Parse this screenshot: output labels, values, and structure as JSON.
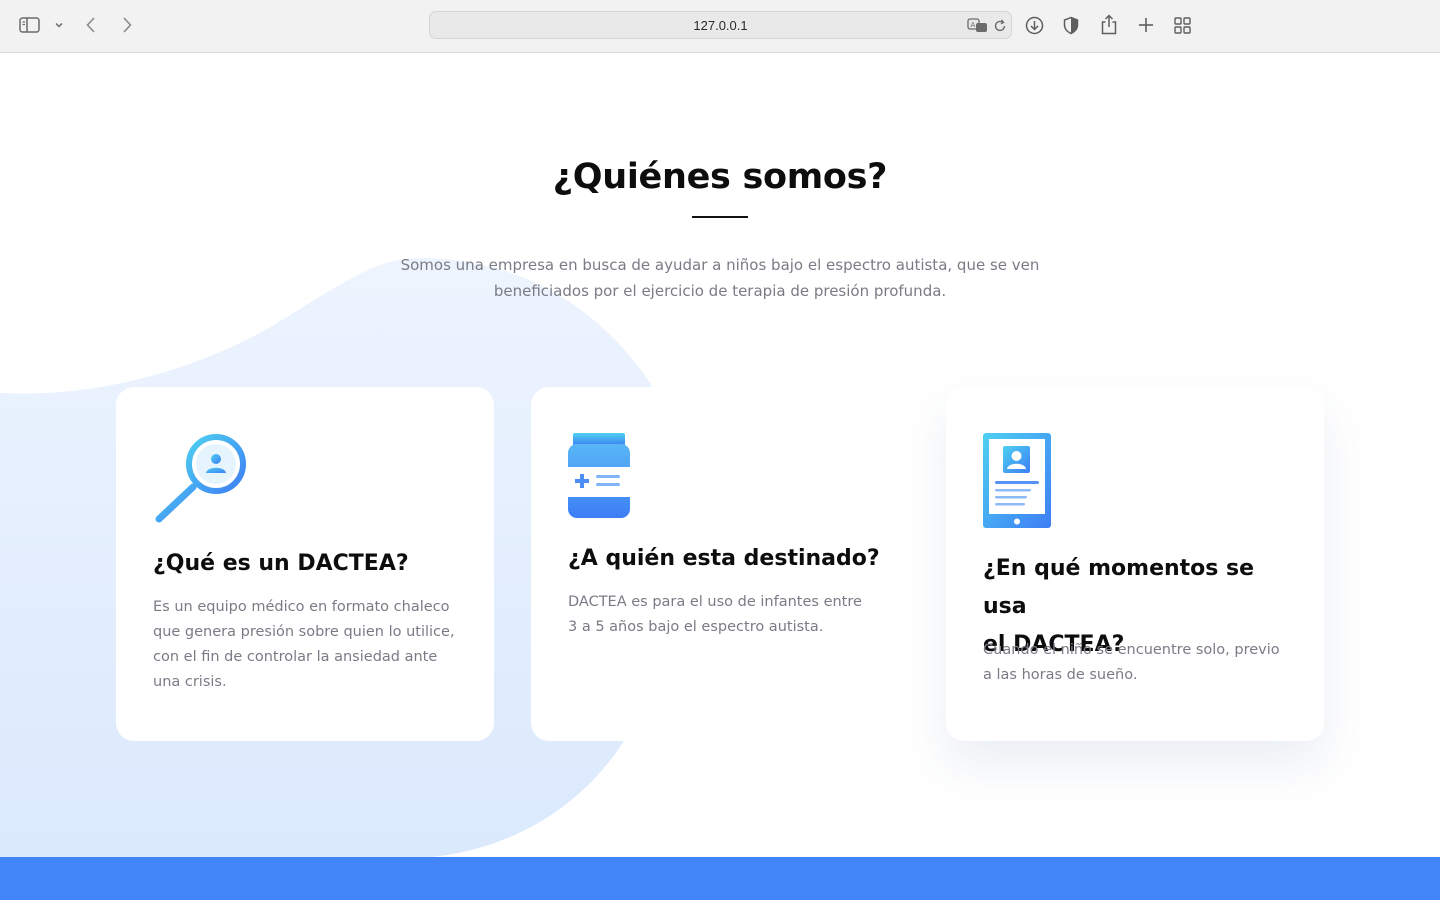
{
  "browser": {
    "url": "127.0.0.1",
    "icons": [
      "sidebar-icon",
      "chevron-down-icon",
      "back-icon",
      "forward-icon",
      "translate-icon",
      "reload-icon",
      "download-icon",
      "shield-icon",
      "share-icon",
      "new-tab-icon",
      "tab-overview-icon"
    ]
  },
  "section": {
    "title": "¿Quiénes somos?",
    "intro_line1": "Somos una empresa en busca de ayudar a niños bajo el espectro autista, que se ven",
    "intro_line2": "beneficiados por el ejercicio de terapia de presión profunda."
  },
  "cards": [
    {
      "icon": "magnifier-person-icon",
      "title": "¿Qué es un DACTEA?",
      "lines": [
        "Es un equipo médico en formato chaleco",
        "que genera presión sobre quien lo utilice,",
        "con el fin de controlar la ansiedad ante",
        "una crisis."
      ]
    },
    {
      "icon": "medicine-jar-icon",
      "title": "¿A quién esta destinado?",
      "lines": [
        "DACTEA es para el uso de infantes entre",
        "3 a 5 años bajo el espectro autista."
      ]
    },
    {
      "icon": "tablet-profile-icon",
      "title_line1": "¿En qué momentos se usa",
      "title_line2": "el DACTEA?",
      "lines": [
        "Cuando el niño se encuentre solo, previo",
        "a las horas de sueño."
      ]
    }
  ],
  "colors": {
    "accent": "#4285f8",
    "blob": "#deeafd",
    "text_muted": "#7b7b86",
    "icon_gradient_start": "#4ed0f0",
    "icon_gradient_end": "#3d7ef5"
  }
}
